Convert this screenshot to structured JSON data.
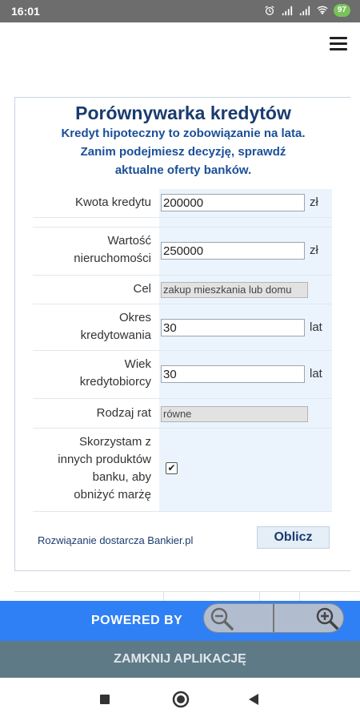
{
  "status_bar": {
    "time": "16:01",
    "battery": "97",
    "icons": [
      "alarm-icon",
      "signal-icon",
      "signal-icon",
      "wifi-icon",
      "battery-icon"
    ]
  },
  "header": {
    "menu_icon": "hamburger-icon"
  },
  "form": {
    "title": "Porównywarka kredytów",
    "subtitle_line1": "Kredyt hipoteczny to zobowiązanie na lata.",
    "subtitle_line2": "Zanim podejmiesz decyzję, sprawdź",
    "subtitle_line3": "aktualne oferty banków.",
    "loan_amount": {
      "label": "Kwota kredytu",
      "value": "200000",
      "unit": "zł"
    },
    "property_value": {
      "label_line1": "Wartość",
      "label_line2": "nieruchomości",
      "value": "250000",
      "unit": "zł"
    },
    "purpose": {
      "label": "Cel",
      "value": "zakup mieszkania lub domu"
    },
    "period": {
      "label_line1": "Okres",
      "label_line2": "kredytowania",
      "value": "30",
      "unit": "lat"
    },
    "age": {
      "label_line1": "Wiek",
      "label_line2": "kredytobiorcy",
      "value": "30",
      "unit": "lat"
    },
    "installments": {
      "label": "Rodzaj rat",
      "value": "równe"
    },
    "other_products": {
      "label_line1": "Skorzystam z",
      "label_line2": "innych produktów",
      "label_line3": "banku, aby",
      "label_line4": "obniżyć marżę",
      "checked": true,
      "check_glyph": "✔"
    },
    "provider_text": "Rozwiązanie dostarcza Bankier.pl",
    "calculate_label": "Oblicz"
  },
  "footer": {
    "powered_by": "POWERED BY",
    "close_app": "ZAMKNIJ APLIKACJĘ",
    "accent_color": "#2f80f5",
    "close_bar_color": "#5f7a87"
  },
  "zoom": {
    "zoom_out_icon": "zoom-out-icon",
    "zoom_in_icon": "zoom-in-icon"
  },
  "nav": {
    "recents_icon": "square-icon",
    "home_icon": "circle-icon",
    "back_icon": "triangle-back-icon"
  }
}
